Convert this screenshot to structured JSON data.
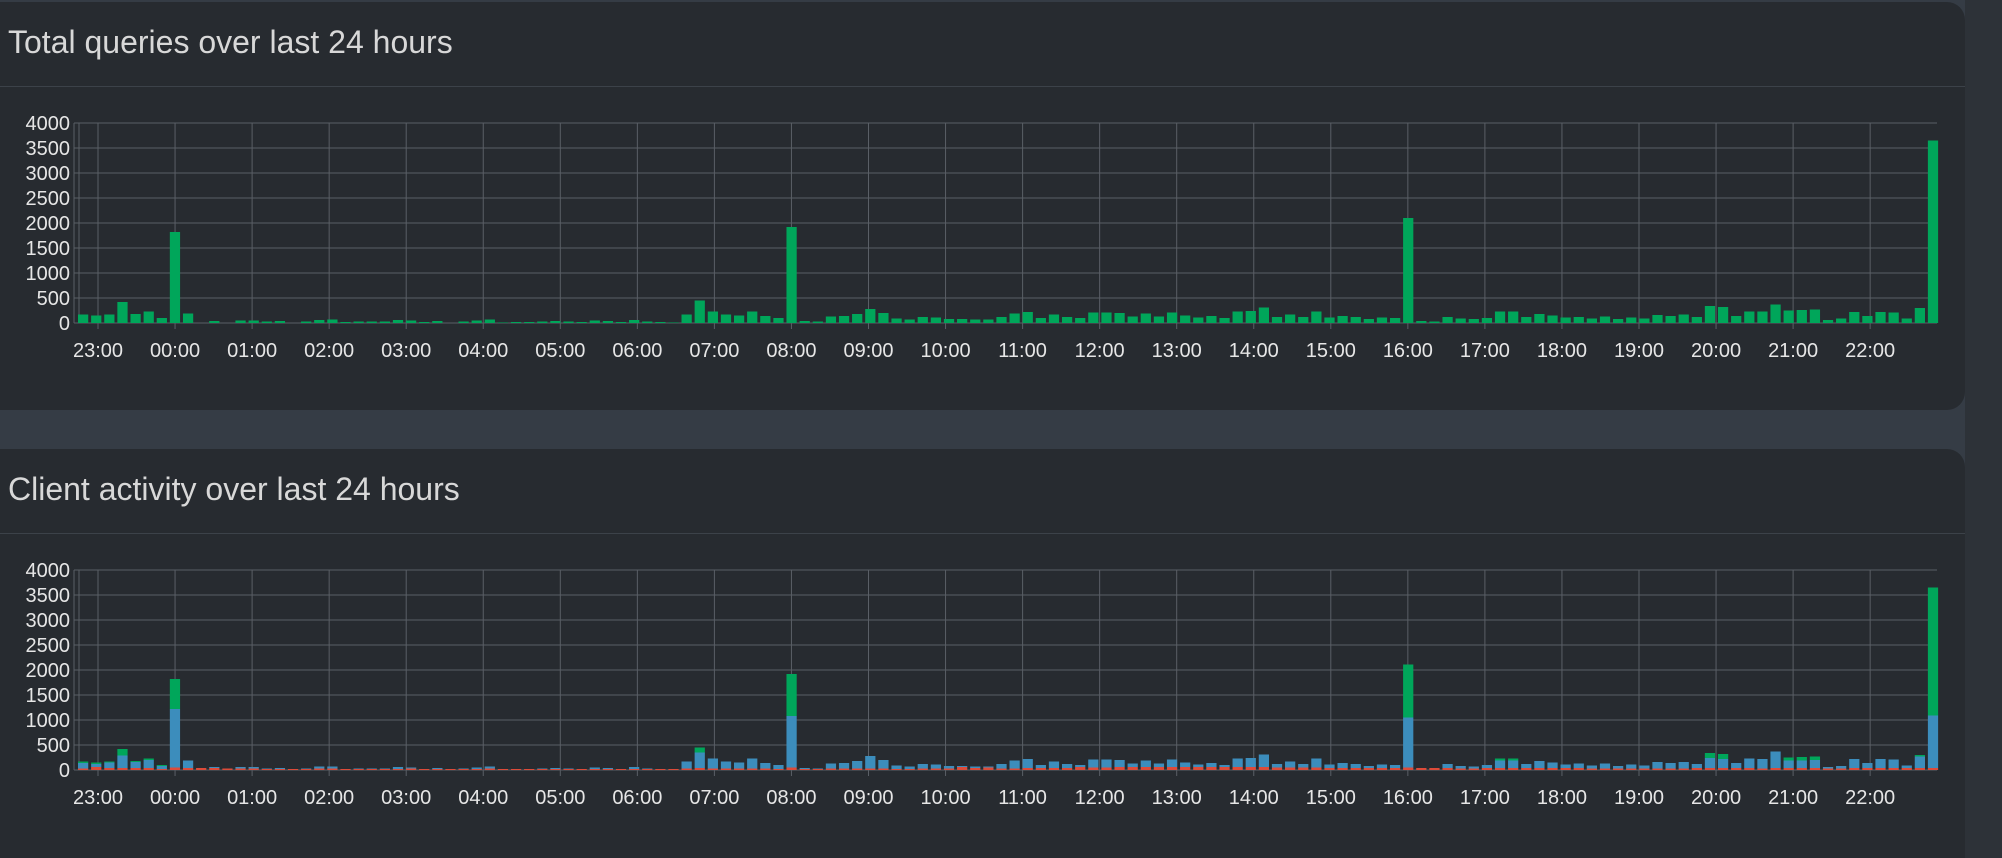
{
  "panels": [
    {
      "title": "Total queries over last 24 hours"
    },
    {
      "title": "Client activity over last 24 hours"
    }
  ],
  "colors": {
    "green": "#00a65a",
    "blue": "#3c8dbc",
    "red": "#dd4b39",
    "grid": "#5a5f66",
    "text": "#e6e6e6"
  },
  "chart_data": [
    {
      "type": "bar",
      "title": "Total queries over last 24 hours",
      "x_ticks": [
        "23:00",
        "00:00",
        "01:00",
        "02:00",
        "03:00",
        "04:00",
        "05:00",
        "06:00",
        "07:00",
        "08:00",
        "09:00",
        "10:00",
        "11:00",
        "12:00",
        "13:00",
        "14:00",
        "15:00",
        "16:00",
        "17:00",
        "18:00",
        "19:00",
        "20:00",
        "21:00",
        "22:00"
      ],
      "y_ticks": [
        "0",
        "500",
        "1000",
        "1500",
        "2000",
        "2500",
        "3000",
        "3500",
        "4000"
      ],
      "ylim": [
        0,
        4000
      ],
      "series": [
        {
          "color": "green",
          "values": [
            170,
            150,
            170,
            420,
            180,
            230,
            100,
            1820,
            190,
            0,
            40,
            0,
            50,
            50,
            30,
            40,
            0,
            30,
            60,
            70,
            20,
            30,
            30,
            30,
            60,
            50,
            20,
            40,
            0,
            30,
            50,
            70,
            10,
            20,
            20,
            30,
            40,
            30,
            20,
            50,
            40,
            20,
            60,
            30,
            20,
            10,
            170,
            450,
            230,
            170,
            150,
            230,
            140,
            100,
            1920,
            40,
            30,
            130,
            140,
            180,
            280,
            200,
            90,
            70,
            120,
            110,
            80,
            80,
            70,
            70,
            120,
            190,
            220,
            100,
            170,
            120,
            100,
            210,
            210,
            200,
            130,
            190,
            130,
            210,
            150,
            110,
            140,
            100,
            230,
            240,
            310,
            120,
            170,
            120,
            230,
            110,
            140,
            120,
            80,
            110,
            100,
            2100,
            40,
            30,
            120,
            90,
            80,
            100,
            230,
            230,
            120,
            180,
            150,
            110,
            120,
            90,
            130,
            80,
            110,
            90,
            160,
            140,
            170,
            120,
            340,
            320,
            140,
            230,
            230,
            370,
            250,
            260,
            270,
            60,
            90,
            220,
            140,
            220,
            210,
            90,
            300,
            3650
          ]
        }
      ]
    },
    {
      "type": "bar",
      "title": "Client activity over last 24 hours",
      "x_ticks": [
        "23:00",
        "00:00",
        "01:00",
        "02:00",
        "03:00",
        "04:00",
        "05:00",
        "06:00",
        "07:00",
        "08:00",
        "09:00",
        "10:00",
        "11:00",
        "12:00",
        "13:00",
        "14:00",
        "15:00",
        "16:00",
        "17:00",
        "18:00",
        "19:00",
        "20:00",
        "21:00",
        "22:00"
      ],
      "y_ticks": [
        "0",
        "500",
        "1000",
        "1500",
        "2000",
        "2500",
        "3000",
        "3500",
        "4000"
      ],
      "ylim": [
        0,
        4000
      ],
      "series": [
        {
          "color": "red",
          "values": [
            30,
            60,
            40,
            40,
            40,
            40,
            20,
            50,
            40,
            40,
            40,
            30,
            30,
            30,
            20,
            20,
            20,
            20,
            30,
            30,
            20,
            20,
            20,
            20,
            20,
            30,
            20,
            20,
            20,
            20,
            20,
            30,
            20,
            20,
            20,
            20,
            20,
            20,
            20,
            20,
            20,
            20,
            20,
            20,
            20,
            20,
            30,
            40,
            30,
            30,
            30,
            30,
            30,
            20,
            50,
            20,
            20,
            30,
            30,
            30,
            30,
            30,
            20,
            20,
            30,
            30,
            30,
            60,
            40,
            50,
            30,
            30,
            40,
            40,
            40,
            40,
            60,
            50,
            50,
            60,
            60,
            60,
            60,
            60,
            60,
            60,
            60,
            60,
            60,
            60,
            60,
            50,
            50,
            50,
            50,
            40,
            40,
            40,
            40,
            40,
            40,
            50,
            40,
            40,
            40,
            30,
            30,
            40,
            40,
            40,
            40,
            40,
            40,
            40,
            40,
            30,
            30,
            30,
            30,
            30,
            30,
            30,
            30,
            40,
            40,
            40,
            40,
            40,
            30,
            40,
            40,
            40,
            40,
            30,
            30,
            40,
            40,
            40,
            40,
            40,
            40,
            40
          ]
        },
        {
          "color": "blue",
          "values": [
            110,
            60,
            110,
            250,
            120,
            160,
            60,
            1170,
            150,
            0,
            20,
            0,
            30,
            30,
            10,
            20,
            0,
            10,
            40,
            40,
            0,
            10,
            10,
            10,
            40,
            20,
            0,
            20,
            0,
            10,
            30,
            40,
            0,
            0,
            0,
            10,
            20,
            10,
            0,
            30,
            20,
            0,
            40,
            10,
            0,
            0,
            140,
            310,
            200,
            140,
            120,
            200,
            110,
            80,
            1030,
            20,
            10,
            100,
            110,
            150,
            250,
            170,
            70,
            50,
            90,
            80,
            50,
            20,
            30,
            20,
            90,
            160,
            180,
            60,
            130,
            80,
            40,
            160,
            160,
            140,
            70,
            130,
            70,
            150,
            90,
            50,
            80,
            40,
            170,
            180,
            250,
            70,
            120,
            70,
            180,
            70,
            100,
            80,
            40,
            70,
            60,
            1000,
            0,
            0,
            80,
            50,
            40,
            60,
            150,
            150,
            80,
            140,
            110,
            70,
            90,
            60,
            100,
            50,
            80,
            60,
            130,
            110,
            130,
            80,
            200,
            180,
            100,
            190,
            190,
            330,
            150,
            150,
            160,
            30,
            50,
            180,
            100,
            180,
            170,
            50,
            230,
            1050
          ]
        },
        {
          "color": "green",
          "values": [
            30,
            30,
            20,
            130,
            20,
            30,
            20,
            600,
            0,
            0,
            0,
            0,
            0,
            0,
            0,
            0,
            0,
            0,
            0,
            0,
            0,
            0,
            0,
            0,
            0,
            0,
            0,
            0,
            0,
            0,
            0,
            0,
            0,
            0,
            0,
            0,
            0,
            0,
            0,
            0,
            0,
            0,
            0,
            0,
            0,
            0,
            0,
            100,
            0,
            0,
            0,
            0,
            0,
            0,
            840,
            0,
            0,
            0,
            0,
            0,
            0,
            0,
            0,
            0,
            0,
            0,
            0,
            0,
            0,
            0,
            0,
            0,
            0,
            0,
            0,
            0,
            0,
            0,
            0,
            0,
            0,
            0,
            0,
            0,
            0,
            0,
            0,
            0,
            0,
            0,
            0,
            0,
            0,
            0,
            0,
            0,
            0,
            0,
            0,
            0,
            0,
            1060,
            0,
            0,
            0,
            0,
            0,
            0,
            40,
            40,
            0,
            0,
            0,
            0,
            0,
            0,
            0,
            0,
            0,
            0,
            0,
            0,
            0,
            0,
            100,
            100,
            0,
            0,
            0,
            0,
            60,
            70,
            70,
            0,
            0,
            0,
            0,
            0,
            0,
            0,
            30,
            2560
          ]
        }
      ]
    }
  ]
}
